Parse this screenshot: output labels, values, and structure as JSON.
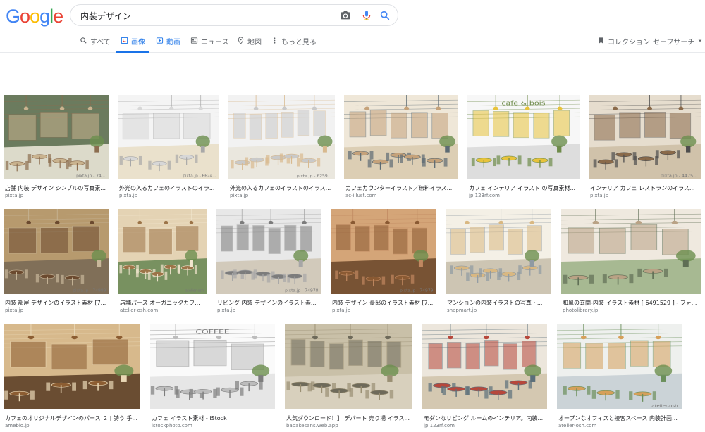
{
  "logo": [
    "G",
    "o",
    "o",
    "g",
    "l",
    "e"
  ],
  "search": {
    "value": "内装デザイン"
  },
  "tabs": {
    "all": "すべて",
    "images": "画像",
    "videos": "動画",
    "news": "ニュース",
    "maps": "地図",
    "more": "もっと見る",
    "collections": "コレクション",
    "safesearch": "セーフサーチ"
  },
  "results": [
    {
      "title": "店舗 内装 デザイン シンプルの写真素...",
      "source": "pixta.jp",
      "watermark": "pixta.jp - 74..."
    },
    {
      "title": "外光の入るカフェのイラストのイラ...",
      "source": "pixta.jp",
      "watermark": "pixta.jp - 6624..."
    },
    {
      "title": "外光の入るカフェのイラストのイラス...",
      "source": "pixta.jp",
      "watermark": "pixta.jp - 6259..."
    },
    {
      "title": "カフェカウンターイラスト／無料イラス...",
      "source": "ac-illust.com"
    },
    {
      "title": "カフェ インテリア イラスト の写真素材...",
      "source": "jp.123rf.com",
      "signage": "cafe & bois"
    },
    {
      "title": "インテリア カフェ レストランのイラス...",
      "source": "pixta.jp",
      "watermark": "pixta.jp - 4475..."
    },
    {
      "title": "内装 部屋 デザインのイラスト素材 [7...",
      "source": "pixta.jp",
      "watermark": "pixta.jp - 74989"
    },
    {
      "title": "店舗パース オーガニックカフ...",
      "source": "atelier-osh.com",
      "watermark": "atelier-osh"
    },
    {
      "title": "リビング 内装 デザインのイラスト素...",
      "source": "pixta.jp",
      "watermark": "pixta.jp - 74978"
    },
    {
      "title": "内装 デザイン 豪邸のイラスト素材 [7...",
      "source": "pixta.jp",
      "watermark": "pixta.jp - 74979"
    },
    {
      "title": "マンションの内装イラストの写真・...",
      "source": "snapmart.jp"
    },
    {
      "title": "和風の玄関-内装 イラスト素材 [ 6491529 ] - フォ...",
      "source": "photolibrary.jp"
    },
    {
      "title": "カフェのオリジナルデザインのパース ２ | 詩う 手...",
      "source": "ameblo.jp"
    },
    {
      "title": "カフェ イラスト素材 - iStock",
      "source": "istockphoto.com",
      "signage": "COFFEE"
    },
    {
      "title": "人気ダウンロード！】 デパート 売り場 イラス...",
      "source": "bapakesans.web.app"
    },
    {
      "title": "モダンなリビング ルームのインテリア。内装...",
      "source": "jp.123rf.com"
    },
    {
      "title": "オープンなオフィスと接客スペース 内装計画イラス...",
      "source": "atelier-osh.com",
      "watermark": "atelier-osh"
    }
  ],
  "colors": {
    "accent": "#1a73e8",
    "border": "#dfe1e5",
    "muted": "#5f6368",
    "source": "#70757a"
  }
}
